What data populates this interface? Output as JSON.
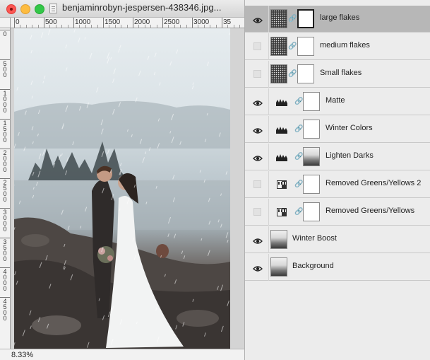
{
  "document": {
    "title": "benjaminrobyn-jespersen-438346.jpg...",
    "zoom": "8.33%",
    "ruler_h_labels": [
      "0",
      "500",
      "1000",
      "1500",
      "2000",
      "2500",
      "3000",
      "35"
    ],
    "ruler_v_labels": [
      "0",
      "500",
      "1000",
      "1500",
      "2000",
      "2500",
      "3000",
      "3500",
      "4000",
      "4500"
    ]
  },
  "layers": [
    {
      "name": "large flakes",
      "visible": true,
      "selected": true,
      "kind": "noise-mask",
      "thumb_icon": "noise-thumbnail"
    },
    {
      "name": "medium flakes",
      "visible": false,
      "selected": false,
      "kind": "noise-mask",
      "thumb_icon": "noise-thumbnail"
    },
    {
      "name": "Small flakes",
      "visible": false,
      "selected": false,
      "kind": "noise-mask",
      "thumb_icon": "noise-thumbnail"
    },
    {
      "name": "Matte",
      "visible": true,
      "selected": false,
      "kind": "curves",
      "thumb_icon": "curves-adjustment-icon"
    },
    {
      "name": "Winter Colors",
      "visible": true,
      "selected": false,
      "kind": "curves",
      "thumb_icon": "curves-adjustment-icon"
    },
    {
      "name": "Lighten Darks",
      "visible": true,
      "selected": false,
      "kind": "curves-photo-mask",
      "thumb_icon": "curves-adjustment-icon"
    },
    {
      "name": "Removed Greens/Yellows 2",
      "visible": false,
      "selected": false,
      "kind": "gradient-map",
      "thumb_icon": "gradient-map-icon"
    },
    {
      "name": "Removed Greens/Yellows",
      "visible": false,
      "selected": false,
      "kind": "gradient-map",
      "thumb_icon": "gradient-map-icon"
    },
    {
      "name": "Winter Boost",
      "visible": true,
      "selected": false,
      "kind": "photo",
      "thumb_icon": "photo-thumbnail"
    },
    {
      "name": "Background",
      "visible": true,
      "selected": false,
      "kind": "photo",
      "thumb_icon": "photo-thumbnail"
    }
  ]
}
